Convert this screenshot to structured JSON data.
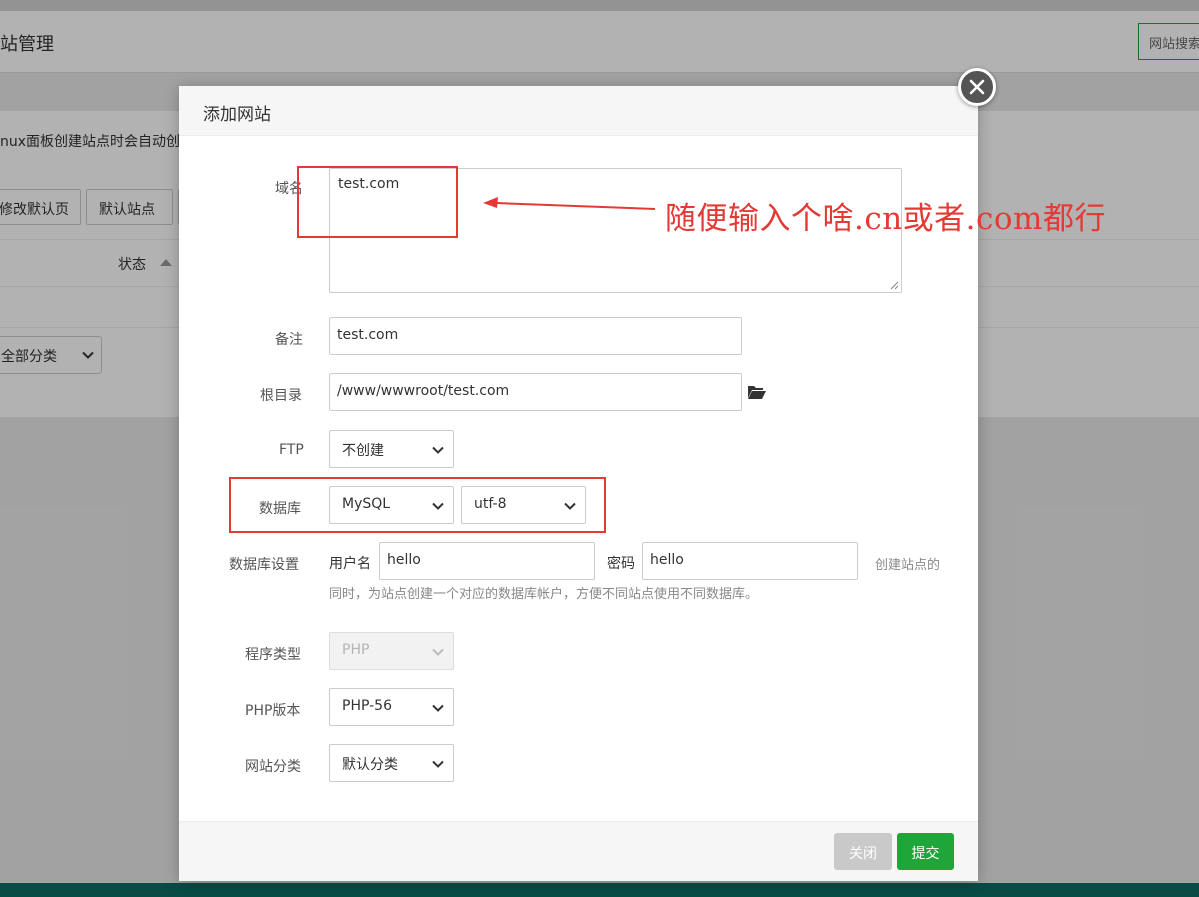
{
  "background": {
    "header_title": "站管理",
    "search_button": "网站搜索",
    "notice": "nux面板创建站点时会自动创",
    "buttons": [
      "修改默认页",
      "默认站点",
      ""
    ],
    "status_column": "状态",
    "category_filter": "全部分类"
  },
  "modal": {
    "title": "添加网站",
    "domain_label": "域名",
    "domain_value": "test.com",
    "remark_label": "备注",
    "remark_value": "test.com",
    "root_label": "根目录",
    "root_value": "/www/wwwroot/test.com",
    "ftp_label": "FTP",
    "ftp_value": "不创建",
    "database_label": "数据库",
    "database_type": "MySQL",
    "database_charset": "utf-8",
    "db_settings_label": "数据库设置",
    "db_user_label": "用户名",
    "db_user_value": "hello",
    "db_password_label": "密码",
    "db_password_value": "hello",
    "db_hint_tail": "创建站点的",
    "db_hint_line2": "同时，为站点创建一个对应的数据库帐户，方便不同站点使用不同数据库。",
    "program_type_label": "程序类型",
    "program_type_value": "PHP",
    "php_version_label": "PHP版本",
    "php_version_value": "PHP-56",
    "site_category_label": "网站分类",
    "site_category_value": "默认分类",
    "close_button": "关闭",
    "submit_button": "提交"
  },
  "annotation": {
    "text": "随便输入个啥.cn或者.com都行",
    "color": "#e53935"
  },
  "colors": {
    "primary": "#20a53a",
    "footer": "#0c6e63"
  }
}
